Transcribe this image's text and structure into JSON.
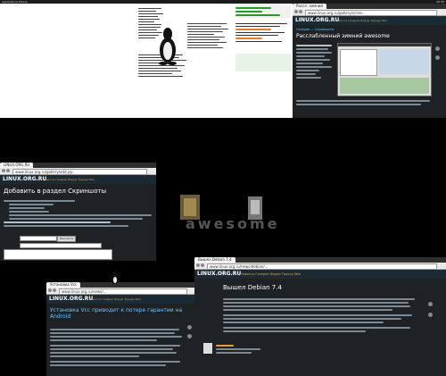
{
  "top_bar": {
    "left_text": "Applications  Places",
    "right_text": "20:35"
  },
  "term_window": {
    "logo_text": "Tux"
  },
  "w1": {
    "tab": "Рассл. зимний",
    "url": "www.linux.org.ru/gallery/scree...",
    "logo": "LINUX.ORG.RU",
    "menu": "Новости  Галерея  Форум  Трекер  Wiki",
    "breadcrumb": "Галерея — Скриншоты",
    "title": "Расслабленный зимний awesome"
  },
  "w2": {
    "tab": "LINUX.ORG.RU",
    "url": "www.linux.org.ru/gallery/add.jsp",
    "logo": "LINUX.ORG.RU",
    "menu": "Новости  Галерея  Форум  Трекер  Wiki",
    "title": "Добавить в раздел Скриншоты",
    "button": "Просмотр",
    "submit": "Поместить"
  },
  "awesome": {
    "logo_text": "awesome"
  },
  "w3": {
    "tab": "Установка Vcc",
    "url": "www.linux.org.ru/news/...",
    "logo": "LINUX.ORG.RU",
    "menu": "Новости  Галерея  Форум  Трекер  Wiki",
    "title": "Установка Vcc приводит к потере гарантии на Android"
  },
  "w4": {
    "tab": "Вышел Debian 7.4",
    "url": "www.linux.org.ru/news/debian/...",
    "logo": "LINUX.ORG.RU",
    "menu": "Новости  Галерея  Форум  Трекер  Wiki",
    "title": "Вышел Debian 7.4"
  },
  "colors": {
    "link": "#6fc3ff",
    "menu": "#e0a040",
    "header": "#1c2a33",
    "bg": "#000000"
  }
}
